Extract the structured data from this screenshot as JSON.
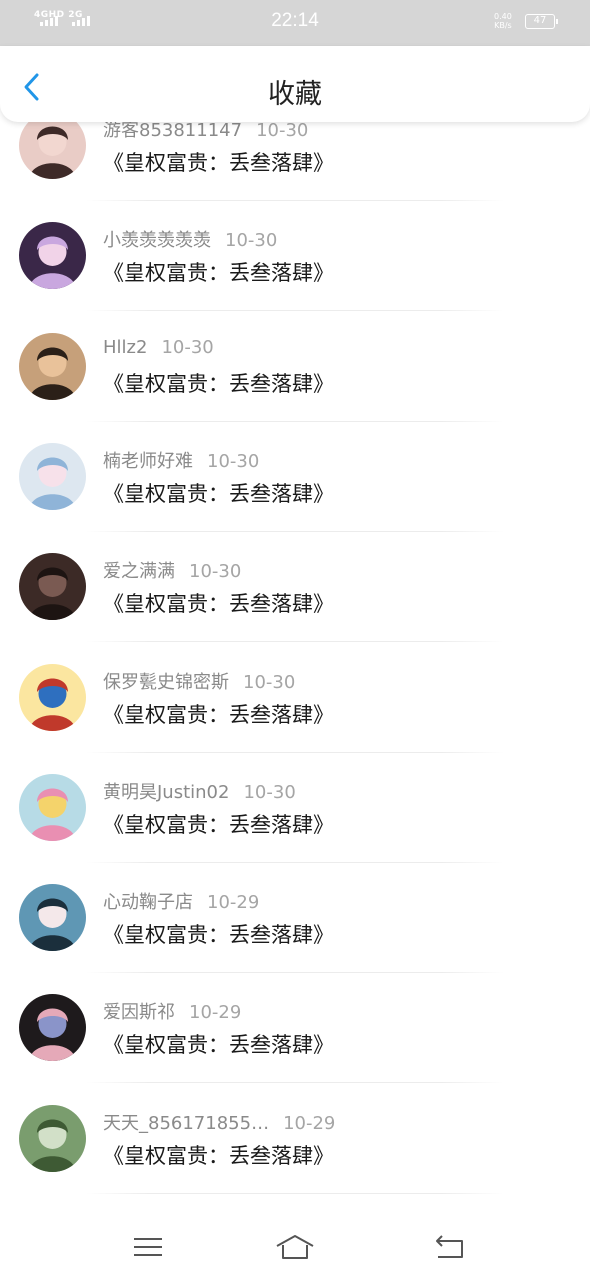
{
  "status_bar": {
    "network": "4GHD 2G",
    "time": "22:14",
    "speed_value": "0.40",
    "speed_unit": "KB/s",
    "battery": "47"
  },
  "header": {
    "title": "收藏",
    "back_icon": "chevron-left-icon"
  },
  "favorites": [
    {
      "user": "游客853811147",
      "date": "10-30",
      "title": "《皇权富贵：丢叁落肆》",
      "avatar": {
        "bg": "#e9ccc6",
        "fg": "#3e2a28",
        "accent": "#f2d7d0"
      }
    },
    {
      "user": "小羡羡羡羡羡",
      "date": "10-30",
      "title": "《皇权富贵：丢叁落肆》",
      "avatar": {
        "bg": "#3a2748",
        "fg": "#c9a7df",
        "accent": "#f1d3e8"
      }
    },
    {
      "user": "Hllz2",
      "date": "10-30",
      "title": "《皇权富贵：丢叁落肆》",
      "avatar": {
        "bg": "#c6a07a",
        "fg": "#2b2018",
        "accent": "#e9c29a"
      }
    },
    {
      "user": "楠老师好难",
      "date": "10-30",
      "title": "《皇权富贵：丢叁落肆》",
      "avatar": {
        "bg": "#dde7f0",
        "fg": "#8fb4d8",
        "accent": "#f7e1ea"
      }
    },
    {
      "user": "爱之满满",
      "date": "10-30",
      "title": "《皇权富贵：丢叁落肆》",
      "avatar": {
        "bg": "#3c2a26",
        "fg": "#1d1412",
        "accent": "#7a5a52"
      }
    },
    {
      "user": "保罗甏史锦密斯",
      "date": "10-30",
      "title": "《皇权富贵：丢叁落肆》",
      "avatar": {
        "bg": "#fbe6a0",
        "fg": "#c0392b",
        "accent": "#2e6fbf"
      }
    },
    {
      "user": "黄明昊Justin02",
      "date": "10-30",
      "title": "《皇权富贵：丢叁落肆》",
      "avatar": {
        "bg": "#b7dbe6",
        "fg": "#e98fb2",
        "accent": "#f4d36b"
      }
    },
    {
      "user": "心动鞠子店",
      "date": "10-29",
      "title": "《皇权富贵：丢叁落肆》",
      "avatar": {
        "bg": "#5f97b4",
        "fg": "#1b2f3c",
        "accent": "#f4e8ea"
      }
    },
    {
      "user": "爱因斯祁",
      "date": "10-29",
      "title": "《皇权富贵：丢叁落肆》",
      "avatar": {
        "bg": "#1e1a1c",
        "fg": "#e5a9b8",
        "accent": "#8a94c9"
      }
    },
    {
      "user": "天天_856171855…",
      "date": "10-29",
      "title": "《皇权富贵：丢叁落肆》",
      "avatar": {
        "bg": "#7a9d6e",
        "fg": "#3e5a34",
        "accent": "#d2e0c8"
      }
    }
  ],
  "nav": {
    "menu_icon": "menu-icon",
    "home_icon": "home-icon",
    "back_icon": "back-arrow-icon"
  }
}
